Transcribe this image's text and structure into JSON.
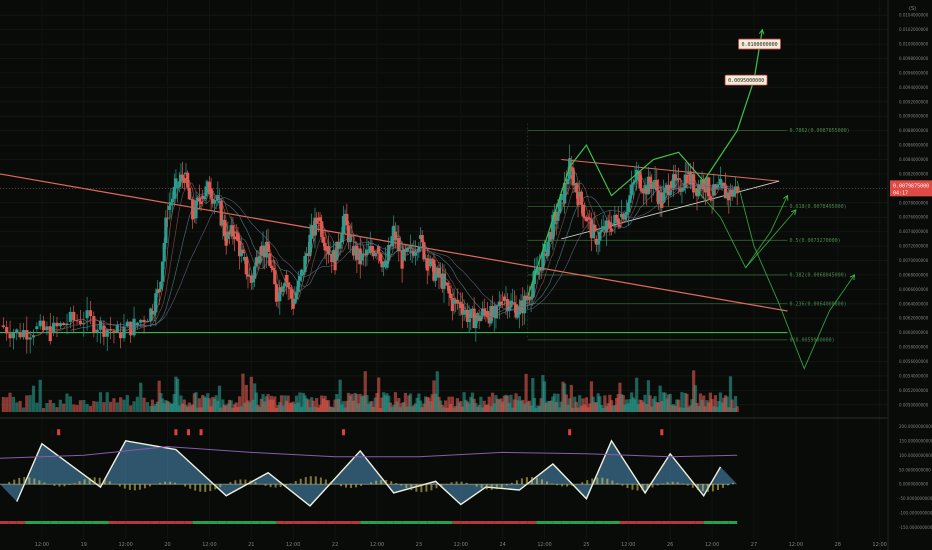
{
  "theme": {
    "background": "#090b09",
    "up_color": "#2a9d8f",
    "down_color": "#e05a50",
    "trend_line": "#e06a5c",
    "support_line": "#3ccf5a",
    "projection": "#3fc24a",
    "oscillator_blue": "#4f93c0",
    "oscillator_yellow": "#e0d060",
    "price_tag": "#e04a44"
  },
  "chart_data": [
    {
      "type": "line",
      "name": "price-pane",
      "scale_label": "(S)",
      "y_ticks": [
        "0.0104000000",
        "0.0102000000",
        "0.0100000000",
        "0.0098000000",
        "0.0096000000",
        "0.0094000000",
        "0.0092000000",
        "0.0090000000",
        "0.0088000000",
        "0.0086000000",
        "0.0084000000",
        "0.0082000000",
        "0.0080000000",
        "0.0078000000",
        "0.0076000000",
        "0.0074000000",
        "0.0072000000",
        "0.0070000000",
        "0.0068000000",
        "0.0066000000",
        "0.0064000000",
        "0.0062000000",
        "0.0060000000",
        "0.0058000000",
        "0.0056000000",
        "0.0054000000",
        "0.0052000000",
        "0.0050000000"
      ],
      "ylim": [
        0.0049,
        0.0105
      ],
      "current_price": "0.0079875000",
      "current_price_sub": "04:17",
      "targets": [
        {
          "label": "0.0100000000",
          "value": 0.01,
          "day": 26.72
        },
        {
          "label": "0.0095000000",
          "value": 0.0095,
          "day": 26.56
        }
      ],
      "fib_levels": [
        {
          "label": "0.7862(0.0087855000)",
          "value": 0.0088
        },
        {
          "label": "0.618(0.0078495000)",
          "value": 0.00775
        },
        {
          "label": "0.5(0.0073270000)",
          "value": 0.00728
        },
        {
          "label": "0.382(0.0068045000)",
          "value": 0.0068
        },
        {
          "label": "0.236(0.0064000000)",
          "value": 0.0064
        },
        {
          "label": "0(0.0059000000)",
          "value": 0.0059
        }
      ],
      "close_series": [
        [
          18.0,
          0.0061
        ],
        [
          18.2,
          0.006
        ],
        [
          18.4,
          0.00605
        ],
        [
          18.6,
          0.006
        ],
        [
          18.8,
          0.00615
        ],
        [
          19.0,
          0.0062
        ],
        [
          19.2,
          0.0061
        ],
        [
          19.4,
          0.006
        ],
        [
          19.6,
          0.0061
        ],
        [
          19.8,
          0.0063
        ],
        [
          19.9,
          0.0066
        ],
        [
          20.0,
          0.0077
        ],
        [
          20.1,
          0.008
        ],
        [
          20.2,
          0.0082
        ],
        [
          20.3,
          0.0076
        ],
        [
          20.4,
          0.0079
        ],
        [
          20.5,
          0.008
        ],
        [
          20.6,
          0.0078
        ],
        [
          20.7,
          0.0073
        ],
        [
          20.8,
          0.0074
        ],
        [
          20.9,
          0.007
        ],
        [
          21.0,
          0.0067
        ],
        [
          21.1,
          0.0072
        ],
        [
          21.2,
          0.0071
        ],
        [
          21.3,
          0.0065
        ],
        [
          21.4,
          0.0068
        ],
        [
          21.5,
          0.0064
        ],
        [
          21.6,
          0.0068
        ],
        [
          21.7,
          0.0073
        ],
        [
          21.8,
          0.0076
        ],
        [
          21.9,
          0.0072
        ],
        [
          22.0,
          0.007
        ],
        [
          22.1,
          0.0076
        ],
        [
          22.2,
          0.0072
        ],
        [
          22.3,
          0.007
        ],
        [
          22.4,
          0.0071
        ],
        [
          22.5,
          0.0072
        ],
        [
          22.6,
          0.0069
        ],
        [
          22.7,
          0.0074
        ],
        [
          22.8,
          0.007
        ],
        [
          22.9,
          0.0071
        ],
        [
          23.0,
          0.0073
        ],
        [
          23.1,
          0.007
        ],
        [
          23.2,
          0.0068
        ],
        [
          23.3,
          0.0067
        ],
        [
          23.4,
          0.0064
        ],
        [
          23.5,
          0.0064
        ],
        [
          23.6,
          0.0062
        ],
        [
          23.7,
          0.0062
        ],
        [
          23.8,
          0.0063
        ],
        [
          23.9,
          0.0062
        ],
        [
          24.0,
          0.0065
        ],
        [
          24.1,
          0.0064
        ],
        [
          24.2,
          0.0063
        ],
        [
          24.3,
          0.0065
        ],
        [
          24.4,
          0.0068
        ],
        [
          24.5,
          0.0071
        ],
        [
          24.6,
          0.0075
        ],
        [
          24.7,
          0.0078
        ],
        [
          24.8,
          0.0083
        ],
        [
          24.9,
          0.0079
        ],
        [
          25.0,
          0.0076
        ],
        [
          25.1,
          0.0073
        ],
        [
          25.2,
          0.0074
        ],
        [
          25.3,
          0.0075
        ],
        [
          25.4,
          0.0076
        ],
        [
          25.5,
          0.0078
        ],
        [
          25.6,
          0.0082
        ],
        [
          25.7,
          0.008
        ],
        [
          25.8,
          0.0081
        ],
        [
          25.9,
          0.0078
        ],
        [
          26.0,
          0.0081
        ],
        [
          26.1,
          0.008
        ],
        [
          26.2,
          0.0082
        ],
        [
          26.3,
          0.008
        ],
        [
          26.4,
          0.0081
        ],
        [
          26.5,
          0.0079
        ],
        [
          26.6,
          0.008
        ],
        [
          26.7,
          0.0079
        ],
        [
          26.8,
          0.008
        ]
      ],
      "resistance_line": [
        [
          18.0,
          0.0082
        ],
        [
          27.4,
          0.0063
        ]
      ],
      "support_line": [
        [
          18.0,
          0.006
        ],
        [
          27.4,
          0.006
        ]
      ],
      "triangle_top": [
        [
          24.7,
          0.0084
        ],
        [
          27.3,
          0.0081
        ]
      ],
      "triangle_bottom": [
        [
          24.7,
          0.0073
        ],
        [
          27.3,
          0.0081
        ]
      ],
      "projections": [
        [
          [
            24.3,
            0.0065
          ],
          [
            24.8,
            0.0083
          ],
          [
            25.0,
            0.0086
          ],
          [
            25.3,
            0.0079
          ],
          [
            25.8,
            0.0084
          ],
          [
            26.1,
            0.0085
          ],
          [
            26.4,
            0.0081
          ],
          [
            26.8,
            0.0088
          ],
          [
            27.0,
            0.0095
          ],
          [
            27.1,
            0.0102
          ]
        ],
        [
          [
            26.3,
            0.008
          ],
          [
            26.6,
            0.0076
          ],
          [
            26.9,
            0.0069
          ],
          [
            27.2,
            0.0074
          ],
          [
            27.4,
            0.0079
          ]
        ],
        [
          [
            26.9,
            0.0069
          ],
          [
            27.2,
            0.0073
          ],
          [
            27.5,
            0.0077
          ]
        ],
        [
          [
            26.8,
            0.0081
          ],
          [
            27.0,
            0.0072
          ],
          [
            27.3,
            0.0064
          ],
          [
            27.6,
            0.0055
          ],
          [
            27.9,
            0.0063
          ],
          [
            28.2,
            0.0068
          ]
        ]
      ],
      "ytick_unit": "price"
    },
    {
      "type": "area",
      "name": "oscillator-pane",
      "y_ticks": [
        "200.0000000000",
        "150.0000000000",
        "100.0000000000",
        "50.0000000000",
        "0.0000000000",
        "-50.0000000000",
        "-100.0000000000",
        "-150.0000000000"
      ],
      "ylim": [
        -165,
        215
      ],
      "wave_tops": [
        [
          18.5,
          140
        ],
        [
          19.5,
          150
        ],
        [
          20.1,
          120
        ],
        [
          21.2,
          40
        ],
        [
          22.3,
          115
        ],
        [
          23.2,
          10
        ],
        [
          23.8,
          -10
        ],
        [
          24.6,
          70
        ],
        [
          25.3,
          150
        ],
        [
          26.0,
          105
        ],
        [
          26.6,
          60
        ]
      ],
      "wave_bottoms": [
        [
          18.2,
          -60
        ],
        [
          19.2,
          -10
        ],
        [
          20.7,
          -40
        ],
        [
          21.7,
          -75
        ],
        [
          22.7,
          -30
        ],
        [
          23.5,
          -70
        ],
        [
          24.2,
          -20
        ],
        [
          25.0,
          -50
        ],
        [
          25.7,
          -30
        ],
        [
          26.4,
          -40
        ]
      ],
      "signal_line": [
        [
          18.0,
          90
        ],
        [
          19.0,
          100
        ],
        [
          20.0,
          130
        ],
        [
          21.0,
          110
        ],
        [
          22.0,
          95
        ],
        [
          23.0,
          95
        ],
        [
          24.0,
          110
        ],
        [
          25.0,
          105
        ],
        [
          26.0,
          95
        ],
        [
          26.8,
          100
        ]
      ],
      "markers": [
        [
          18.7,
          "red"
        ],
        [
          20.1,
          "red"
        ],
        [
          20.25,
          "red"
        ],
        [
          20.4,
          "red"
        ],
        [
          22.1,
          "red"
        ],
        [
          24.8,
          "red"
        ],
        [
          25.9,
          "red"
        ]
      ]
    }
  ],
  "x_axis": {
    "labels": [
      "12:00",
      "19",
      "12:00",
      "20",
      "12:00",
      "21",
      "12:00",
      "22",
      "12:00",
      "23",
      "12:00",
      "24",
      "12:00",
      "25",
      "12:00",
      "26",
      "12:00",
      "27",
      "12:00",
      "28",
      "12:00"
    ]
  }
}
